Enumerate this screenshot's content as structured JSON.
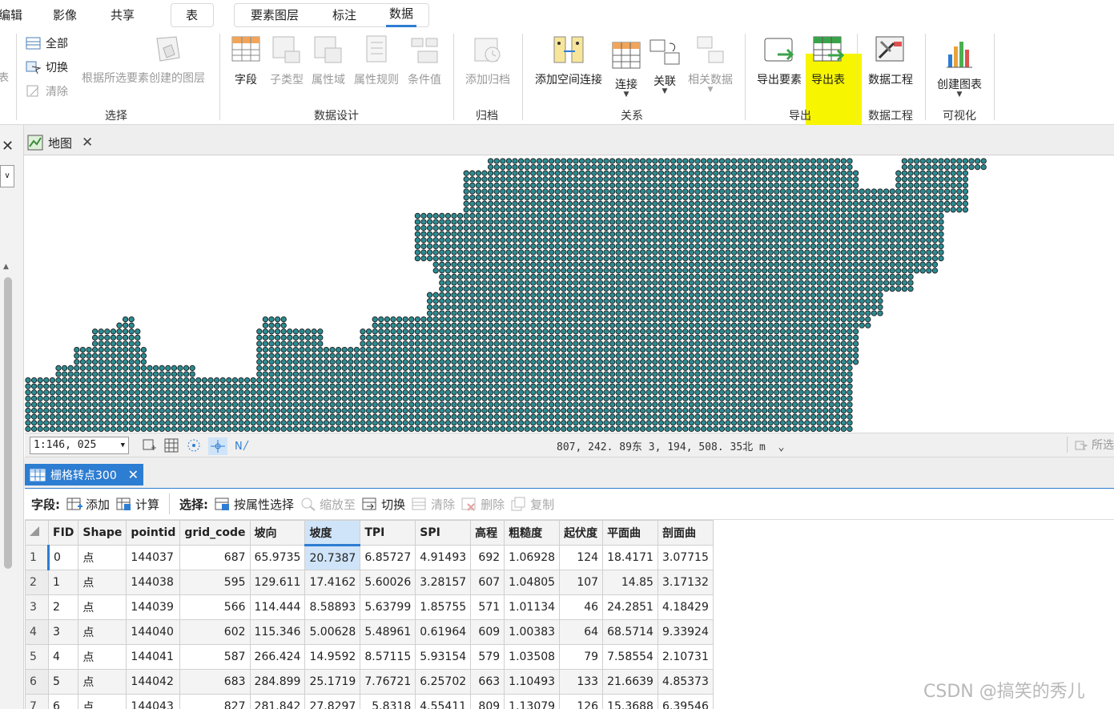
{
  "ribbon_tabs": [
    {
      "label": "编辑"
    },
    {
      "label": "影像"
    },
    {
      "label": "共享"
    },
    {
      "label": "表"
    },
    {
      "label": "要素图层"
    },
    {
      "label": "标注"
    },
    {
      "label": "数据"
    }
  ],
  "ribbon": {
    "selection": {
      "all": "全部",
      "switch": "切换",
      "clear": "清除",
      "create_layer": "根据所选要素创建的图层",
      "group": "选择"
    },
    "data_design": {
      "field": "字段",
      "subtype": "子类型",
      "domain": "属性域",
      "rules": "属性规则",
      "condition": "条件值",
      "group": "数据设计"
    },
    "archive": {
      "add_archive": "添加归档",
      "group": "归档"
    },
    "relations": {
      "spatial_join": "添加空间连接",
      "join": "连接",
      "relate": "关联",
      "related_data": "相关数据",
      "group": "关系"
    },
    "export": {
      "export_features": "导出要素",
      "export_table": "导出表",
      "group": "导出"
    },
    "engineering": {
      "label": "数据工程",
      "group": "数据工程"
    },
    "visualize": {
      "create_chart": "创建图表",
      "group": "可视化"
    }
  },
  "map_tab": {
    "title": "地图"
  },
  "status": {
    "scale": "1:146, 025",
    "coordinates": "807, 242. 89东  3, 194, 508. 35北  m",
    "selected_label": "所选"
  },
  "table_tab": {
    "title": "栅格转点300"
  },
  "table_toolbar": {
    "field_label": "字段:",
    "add": "添加",
    "calculate": "计算",
    "select_label": "选择:",
    "select_by_attr": "按属性选择",
    "zoom_to": "缩放至",
    "switch": "切换",
    "clear": "清除",
    "delete": "删除",
    "copy": "复制"
  },
  "table": {
    "columns": [
      "FID",
      "Shape",
      "pointid",
      "grid_code",
      "坡向",
      "坡度",
      "TPI",
      "SPI",
      "高程",
      "粗糙度",
      "起伏度",
      "平面曲",
      "剖面曲"
    ],
    "rows": [
      [
        "1",
        "0",
        "点",
        "144037",
        "687",
        "65.9735",
        "20.7387",
        "6.85727",
        "4.91493",
        "692",
        "1.06928",
        "124",
        "18.4171",
        "3.07715"
      ],
      [
        "2",
        "1",
        "点",
        "144038",
        "595",
        "129.611",
        "17.4162",
        "5.60026",
        "3.28157",
        "607",
        "1.04805",
        "107",
        "14.85",
        "3.17132"
      ],
      [
        "3",
        "2",
        "点",
        "144039",
        "566",
        "114.444",
        "8.58893",
        "5.63799",
        "1.85755",
        "571",
        "1.01134",
        "46",
        "24.2851",
        "4.18429"
      ],
      [
        "4",
        "3",
        "点",
        "144040",
        "602",
        "115.346",
        "5.00628",
        "5.48961",
        "0.61964",
        "609",
        "1.00383",
        "64",
        "68.5714",
        "9.33924"
      ],
      [
        "5",
        "4",
        "点",
        "144041",
        "587",
        "266.424",
        "14.9592",
        "8.57115",
        "5.93154",
        "579",
        "1.03508",
        "79",
        "7.58554",
        "2.10731"
      ],
      [
        "6",
        "5",
        "点",
        "144042",
        "683",
        "284.899",
        "25.1719",
        "7.76721",
        "6.25702",
        "663",
        "1.10493",
        "133",
        "21.6639",
        "4.85373"
      ],
      [
        "7",
        "6",
        "点",
        "144043",
        "827",
        "281.842",
        "27.8297",
        "5.8318",
        "4.55411",
        "809",
        "1.13079",
        "126",
        "15.3688",
        "6.39546"
      ]
    ]
  },
  "watermark": "CSDN @搞笑的秀儿",
  "colors": {
    "accent": "#2d7dd2",
    "highlight": "#f7f500",
    "point_fill": "#2b8c92"
  }
}
